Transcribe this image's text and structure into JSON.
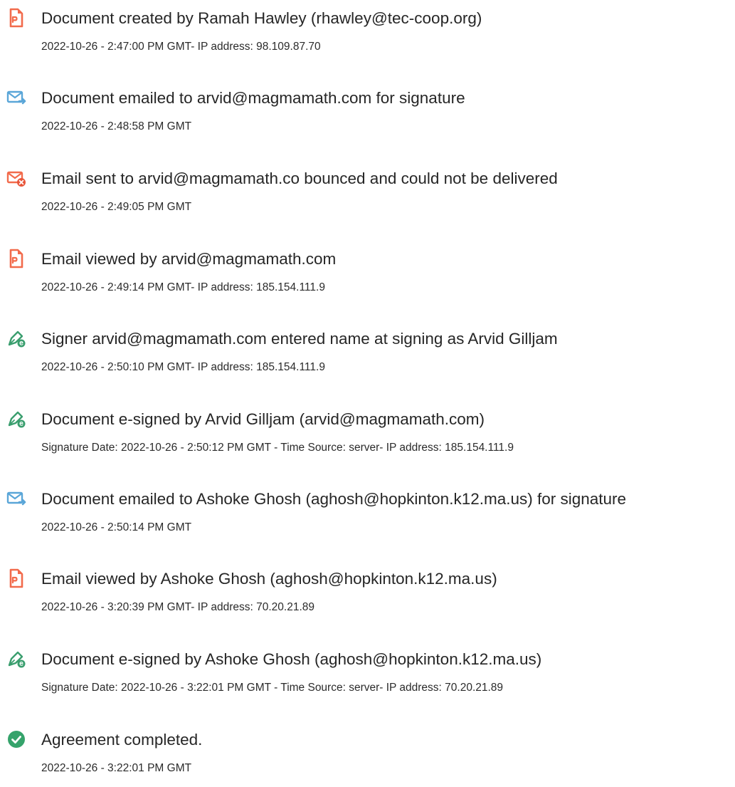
{
  "colors": {
    "doc_orange": "#f26b4c",
    "email_blue": "#5aa6d8",
    "sign_green": "#3a9e6e",
    "complete_green": "#35a36b",
    "error_red": "#e8553a"
  },
  "events": [
    {
      "icon": "document-icon",
      "title": "Document created by Ramah Hawley (rhawley@tec-coop.org)",
      "detail": "2022-10-26 - 2:47:00 PM GMT- IP address: 98.109.87.70"
    },
    {
      "icon": "email-sent-icon",
      "title": "Document emailed to arvid@magmamath.com for signature",
      "detail": "2022-10-26 - 2:48:58 PM GMT"
    },
    {
      "icon": "email-bounced-icon",
      "title": "Email sent to arvid@magmamath.co bounced and could not be delivered",
      "detail": "2022-10-26 - 2:49:05 PM GMT"
    },
    {
      "icon": "document-icon",
      "title": "Email viewed by arvid@magmamath.com",
      "detail": "2022-10-26 - 2:49:14 PM GMT- IP address: 185.154.111.9"
    },
    {
      "icon": "signature-pen-icon",
      "title": "Signer arvid@magmamath.com entered name at signing as Arvid Gilljam",
      "detail": "2022-10-26 - 2:50:10 PM GMT- IP address: 185.154.111.9"
    },
    {
      "icon": "signature-pen-icon",
      "title": "Document e-signed by Arvid Gilljam (arvid@magmamath.com)",
      "detail": "Signature Date: 2022-10-26 - 2:50:12 PM GMT - Time Source: server- IP address: 185.154.111.9"
    },
    {
      "icon": "email-sent-icon",
      "title": "Document emailed to Ashoke Ghosh (aghosh@hopkinton.k12.ma.us) for signature",
      "detail": "2022-10-26 - 2:50:14 PM GMT"
    },
    {
      "icon": "document-icon",
      "title": "Email viewed by Ashoke Ghosh (aghosh@hopkinton.k12.ma.us)",
      "detail": "2022-10-26 - 3:20:39 PM GMT- IP address: 70.20.21.89"
    },
    {
      "icon": "signature-pen-icon",
      "title": "Document e-signed by Ashoke Ghosh (aghosh@hopkinton.k12.ma.us)",
      "detail": "Signature Date: 2022-10-26 - 3:22:01 PM GMT - Time Source: server- IP address: 70.20.21.89"
    },
    {
      "icon": "check-circle-icon",
      "title": "Agreement completed.",
      "detail": "2022-10-26 - 3:22:01 PM GMT"
    }
  ]
}
